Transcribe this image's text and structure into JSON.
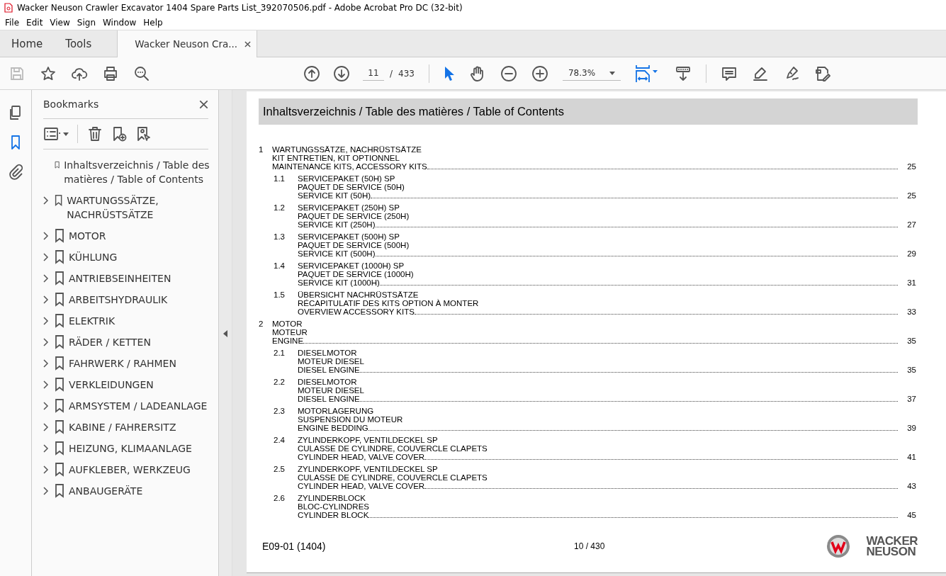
{
  "window": {
    "title": "Wacker Neuson Crawler Excavator 1404 Spare Parts List_392070506.pdf - Adobe Acrobat Pro DC (32-bit)"
  },
  "menu": [
    "File",
    "Edit",
    "View",
    "Sign",
    "Window",
    "Help"
  ],
  "tabs": [
    {
      "label": "Home",
      "selected": false
    },
    {
      "label": "Tools",
      "selected": false
    },
    {
      "label": "Wacker Neuson Cra...",
      "selected": true
    }
  ],
  "toolbar": {
    "page_number": "11",
    "page_separator": "/",
    "page_total": "433",
    "zoom": "78.3%"
  },
  "rail": [
    {
      "kind": "pages",
      "selected": false
    },
    {
      "kind": "bookmarks",
      "selected": true
    },
    {
      "kind": "attachments",
      "selected": false
    }
  ],
  "bookmarks": {
    "title": "Bookmarks",
    "items": [
      {
        "label": "Inhaltsverzeichnis / Table des matières / Table of Contents",
        "kind": "leaf"
      },
      {
        "label": "WARTUNGSSÄTZE, NACHRÜSTSÄTZE",
        "kind": "branch"
      },
      {
        "label": "MOTOR",
        "kind": "branch"
      },
      {
        "label": "KÜHLUNG",
        "kind": "branch"
      },
      {
        "label": "ANTRIEBSEINHEITEN",
        "kind": "branch"
      },
      {
        "label": "ARBEITSHYDRAULIK",
        "kind": "branch"
      },
      {
        "label": "ELEKTRIK",
        "kind": "branch"
      },
      {
        "label": "RÄDER / KETTEN",
        "kind": "branch"
      },
      {
        "label": "FAHRWERK / RAHMEN",
        "kind": "branch"
      },
      {
        "label": "VERKLEIDUNGEN",
        "kind": "branch"
      },
      {
        "label": "ARMSYSTEM / LADEANLAGE",
        "kind": "branch"
      },
      {
        "label": "KABINE / FAHRERSITZ",
        "kind": "branch"
      },
      {
        "label": "HEIZUNG, KLIMAANLAGE",
        "kind": "branch"
      },
      {
        "label": "AUFKLEBER, WERKZEUG",
        "kind": "branch"
      },
      {
        "label": "ANBAUGERÄTE",
        "kind": "branch"
      }
    ]
  },
  "document": {
    "heading": "Inhaltsverzeichnis / Table des matières / Table of Contents",
    "toc": [
      {
        "number": "1",
        "lines": [
          "WARTUNGSSÄTZE, NACHRÜSTSÄTZE",
          "KIT ENTRETIEN, KIT OPTIONNEL",
          "MAINTENANCE KITS, ACCESSORY KITS"
        ],
        "page": "25",
        "children": [
          {
            "number": "1.1",
            "lines": [
              "SERVICEPAKET (50H) SP",
              "PAQUET DE SERVICE (50H)",
              "SERVICE KIT (50H)"
            ],
            "page": "25"
          },
          {
            "number": "1.2",
            "lines": [
              "SERVICEPAKET (250H) SP",
              "PAQUET DE SERVICE (250H)",
              "SERVICE KIT (250H)"
            ],
            "page": "27"
          },
          {
            "number": "1.3",
            "lines": [
              "SERVICEPAKET (500H) SP",
              "PAQUET DE SERVICE (500H)",
              "SERVICE KIT (500H)"
            ],
            "page": "29"
          },
          {
            "number": "1.4",
            "lines": [
              "SERVICEPAKET (1000H) SP",
              "PAQUET DE SERVICE (1000H)",
              "SERVICE KIT (1000H)"
            ],
            "page": "31"
          },
          {
            "number": "1.5",
            "lines": [
              "ÜBERSICHT NACHRÜSTSÄTZE",
              "RÉCAPITULATIF DES KITS OPTION À MONTER",
              "OVERVIEW ACCESSORY KITS"
            ],
            "page": "33"
          }
        ]
      },
      {
        "number": "2",
        "lines": [
          "MOTOR",
          "MOTEUR",
          "ENGINE"
        ],
        "page": "35",
        "children": [
          {
            "number": "2.1",
            "lines": [
              "DIESELMOTOR",
              "MOTEUR DIESEL",
              "DIESEL ENGINE"
            ],
            "page": "35"
          },
          {
            "number": "2.2",
            "lines": [
              "DIESELMOTOR",
              "MOTEUR DIESEL",
              "DIESEL ENGINE"
            ],
            "page": "37"
          },
          {
            "number": "2.3",
            "lines": [
              "MOTORLAGERUNG",
              "SUSPENSION DU MOTEUR",
              "ENGINE BEDDING"
            ],
            "page": "39"
          },
          {
            "number": "2.4",
            "lines": [
              "ZYLINDERKOPF, VENTILDECKEL SP",
              "CULASSE DE CYLINDRE, COUVERCLE CLAPETS",
              "CYLINDER HEAD, VALVE COVER"
            ],
            "page": "41"
          },
          {
            "number": "2.5",
            "lines": [
              "ZYLINDERKOPF, VENTILDECKEL SP",
              "CULASSE DE CYLINDRE, COUVERCLE CLAPETS",
              "CYLINDER HEAD, VALVE COVER"
            ],
            "page": "43"
          },
          {
            "number": "2.6",
            "lines": [
              "ZYLINDERBLOCK",
              "BLOC-CYLINDRES",
              "CYLINDER BLOCK"
            ],
            "page": "45"
          }
        ]
      }
    ],
    "footer": {
      "code": "E09-01 (1404)",
      "page_label": "10 / 430",
      "logo_text": [
        "WACKER",
        "NEUSON"
      ]
    }
  }
}
